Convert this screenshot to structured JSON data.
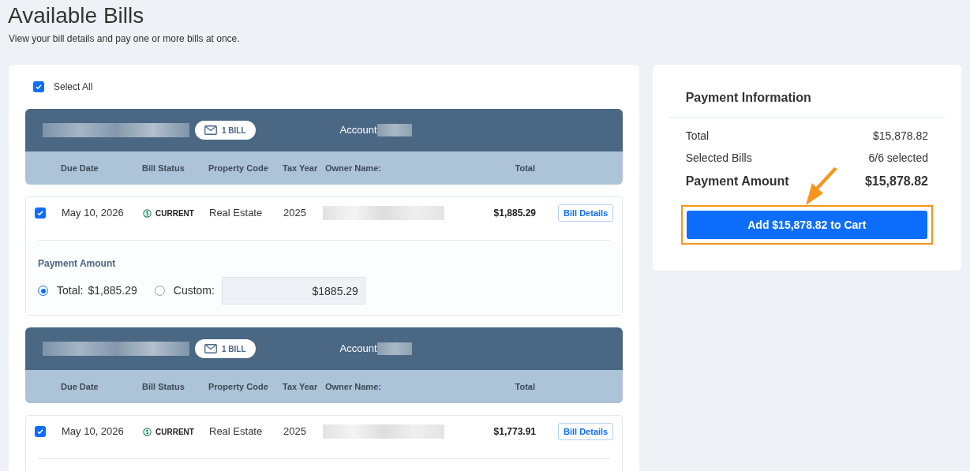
{
  "page": {
    "title": "Available Bills",
    "subtitle": "View your bill details and pay one or more bills at once."
  },
  "select_all": {
    "label": "Select All",
    "checked": true
  },
  "bill_groups": [
    {
      "badge": "1 BILL",
      "account_label": "Account",
      "columns": [
        "Due Date",
        "Bill Status",
        "Property Code",
        "Tax Year",
        "Owner Name:",
        "Total"
      ],
      "bill": {
        "checked": true,
        "due_date": "May 10, 2026",
        "status": "CURRENT",
        "property_code": "Real Estate",
        "tax_year": "2025",
        "total": "$1,885.29",
        "details_button": "Bill Details",
        "payment": {
          "label": "Payment Amount",
          "options": [
            {
              "kind": "total",
              "label": "Total:",
              "amount": "$1,885.29",
              "selected": true
            },
            {
              "kind": "custom",
              "label": "Custom:",
              "value": "$1885.29",
              "selected": false
            }
          ]
        }
      }
    },
    {
      "badge": "1 BILL",
      "account_label": "Account",
      "columns": [
        "Due Date",
        "Bill Status",
        "Property Code",
        "Tax Year",
        "Owner Name:",
        "Total"
      ],
      "bill": {
        "checked": true,
        "due_date": "May 10, 2026",
        "status": "CURRENT",
        "property_code": "Real Estate",
        "tax_year": "2025",
        "total": "$1,773.91",
        "details_button": "Bill Details"
      }
    }
  ],
  "payment_info": {
    "title": "Payment Information",
    "rows": [
      {
        "label": "Total",
        "value": "$15,878.82",
        "emphasis": false
      },
      {
        "label": "Selected Bills",
        "value": "6/6 selected",
        "emphasis": false
      },
      {
        "label": "Payment Amount",
        "value": "$15,878.82",
        "emphasis": true
      }
    ],
    "button": "Add $15,878.82 to Cart",
    "highlighted": true
  }
}
